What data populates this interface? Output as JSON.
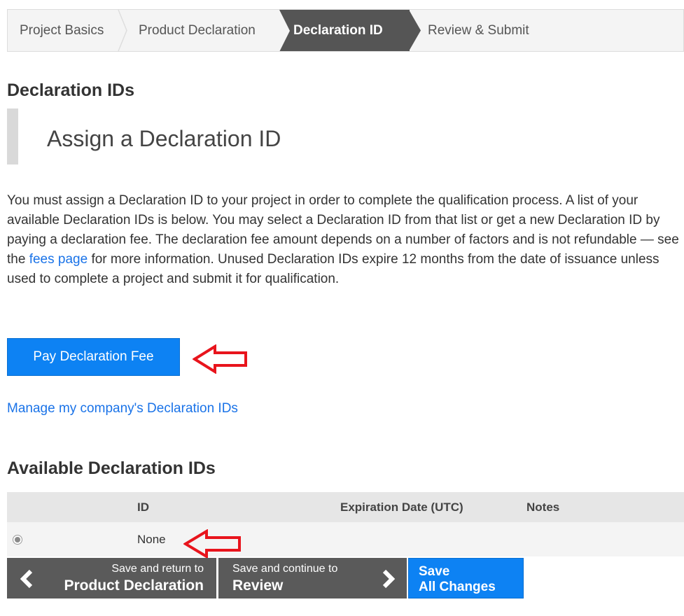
{
  "steps": [
    {
      "label": "Project Basics"
    },
    {
      "label": "Product Declaration"
    },
    {
      "label": "Declaration ID"
    },
    {
      "label": "Review & Submit"
    }
  ],
  "section1": {
    "heading": "Declaration IDs"
  },
  "callout": {
    "title": "Assign a Declaration ID"
  },
  "intro": {
    "text_before": "You must assign a Declaration ID to your project in order to complete the qualification process. A list of your available Declaration IDs is below. You may select a Declaration ID from that list or get a new Declaration ID by paying a declaration fee. The declaration fee amount depends on a number of factors and is not refundable — see the ",
    "link": "fees page",
    "text_after": " for more information. Unused Declaration IDs expire 12 months from the date of issuance unless used to complete a project and submit it for qualification."
  },
  "pay_button": "Pay Declaration Fee",
  "manage_link": "Manage my company's Declaration IDs",
  "section2": {
    "heading": "Available Declaration IDs"
  },
  "table": {
    "columns": [
      "ID",
      "Expiration Date (UTC)",
      "Notes"
    ],
    "rows": [
      {
        "id": "None",
        "expiration": "",
        "notes": "",
        "selected": true
      }
    ]
  },
  "footer": {
    "back": {
      "small": "Save and return to",
      "big": "Product Declaration"
    },
    "next": {
      "small": "Save and continue to",
      "big": "Review"
    },
    "save": {
      "line1": "Save",
      "line2": "All Changes"
    }
  },
  "colors": {
    "active_step": "#555555",
    "primary_button": "#0d82f3",
    "link": "#1a73e8",
    "annotation_arrow": "#e8141c",
    "dark_button": "#5a5a5a"
  },
  "icons": [
    "chevron-left-icon",
    "chevron-right-icon",
    "radio-selected-icon",
    "annotation-arrow-icon"
  ]
}
